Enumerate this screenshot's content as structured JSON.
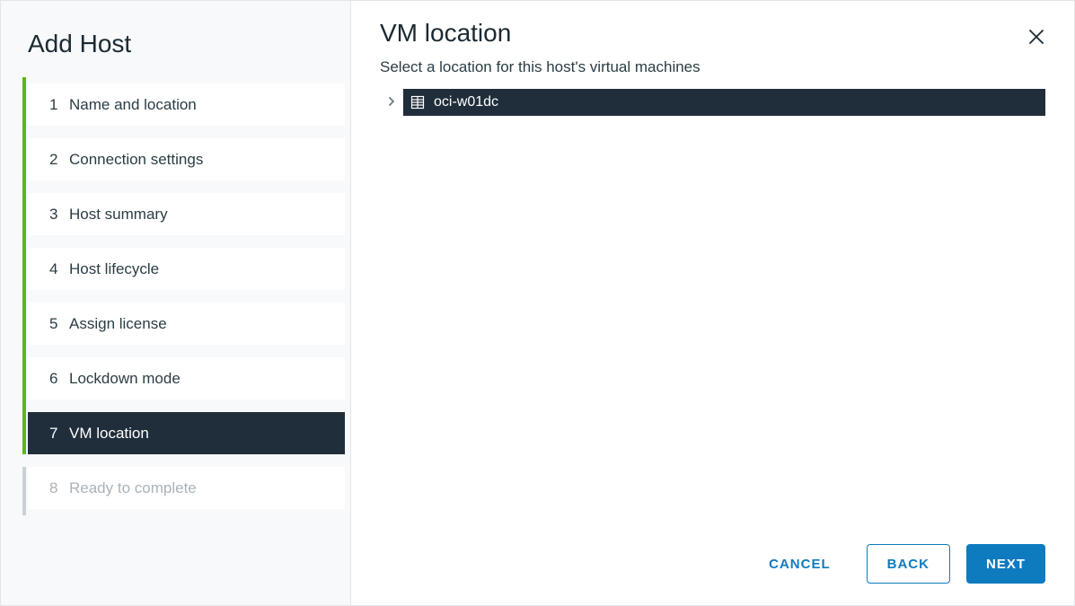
{
  "sidebar": {
    "title": "Add Host",
    "steps": [
      {
        "num": "1",
        "label": "Name and location",
        "state": "done"
      },
      {
        "num": "2",
        "label": "Connection settings",
        "state": "done"
      },
      {
        "num": "3",
        "label": "Host summary",
        "state": "done"
      },
      {
        "num": "4",
        "label": "Host lifecycle",
        "state": "done"
      },
      {
        "num": "5",
        "label": "Assign license",
        "state": "done"
      },
      {
        "num": "6",
        "label": "Lockdown mode",
        "state": "done"
      },
      {
        "num": "7",
        "label": "VM location",
        "state": "active"
      },
      {
        "num": "8",
        "label": "Ready to complete",
        "state": "disabled"
      }
    ]
  },
  "main": {
    "title": "VM location",
    "subtitle": "Select a location for this host's virtual machines",
    "tree": {
      "selected": {
        "label": "oci-w01dc",
        "expanded": false
      }
    }
  },
  "footer": {
    "cancel": "CANCEL",
    "back": "BACK",
    "next": "NEXT"
  }
}
